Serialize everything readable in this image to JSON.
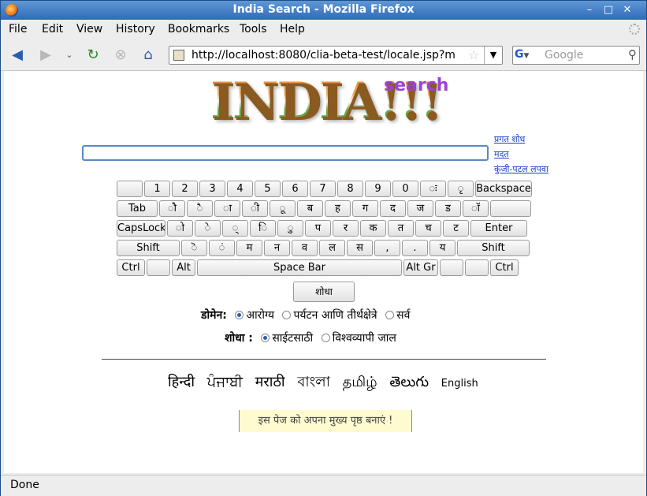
{
  "window": {
    "title": "India Search - Mozilla Firefox"
  },
  "menu": [
    "File",
    "Edit",
    "View",
    "History",
    "Bookmarks",
    "Tools",
    "Help"
  ],
  "url": "http://localhost:8080/clia-beta-test/locale.jsp?m",
  "search_engine_placeholder": "Google",
  "logo": {
    "india": "INDIA!!!",
    "search": "search"
  },
  "side_links": [
    "प्रगत शोध",
    "मदत",
    "कुंजी-पटल लपवा"
  ],
  "keyboard": {
    "row1": [
      "",
      "1",
      "2",
      "3",
      "4",
      "5",
      "6",
      "7",
      "8",
      "9",
      "0",
      "ः",
      "ृ",
      "Backspace"
    ],
    "row2": [
      "Tab",
      "ौ",
      "ै",
      "ा",
      "ी",
      "ू",
      "ब",
      "ह",
      "ग",
      "द",
      "ज",
      "ड",
      "ॉ",
      ""
    ],
    "row3": [
      "CapsLock",
      "ो",
      "े",
      "्",
      "ि",
      "ु",
      "प",
      "र",
      "क",
      "त",
      "च",
      "ट",
      "Enter"
    ],
    "row4": [
      "Shift",
      "ॆ",
      "ं",
      "म",
      "न",
      "व",
      "ल",
      "स",
      ",",
      ".",
      "य",
      "Shift"
    ],
    "row5": [
      "Ctrl",
      "",
      "Alt",
      "Space Bar",
      "Alt Gr",
      "",
      "",
      "Ctrl"
    ]
  },
  "search_button": "शोधा",
  "domain": {
    "label": "डोमेन:",
    "options": [
      "आरोग्य",
      "पर्यटन आणि तीर्थक्षेत्रे",
      "सर्व"
    ],
    "selected": 0
  },
  "scope": {
    "label": "शोधा :",
    "options": [
      "साईटसाठी",
      "विश्वव्यापी जाल"
    ],
    "selected": 0
  },
  "languages": [
    "हिन्दी",
    "ਪੰਜਾਬੀ",
    "मराठी",
    "বাংলা",
    "தமிழ்",
    "తెలుగు",
    "English"
  ],
  "homepage_banner": "इस पेज को अपना मुख्य पृष्ठ बनाएं !",
  "status": "Done"
}
